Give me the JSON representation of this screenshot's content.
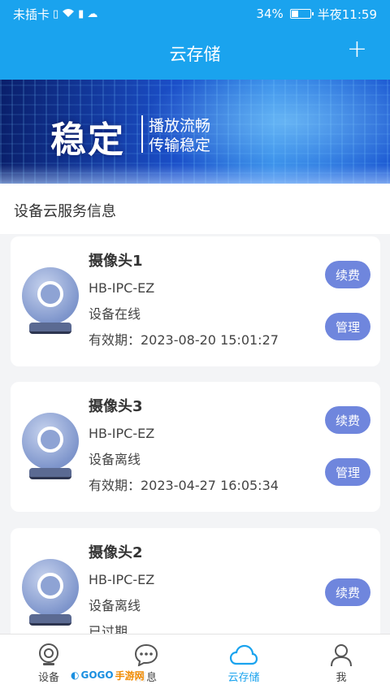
{
  "status_bar": {
    "carrier": "未插卡",
    "battery": "34%",
    "battery_level": 0.34,
    "time": "半夜11:59"
  },
  "header": {
    "title": "云存储",
    "add_label": "+"
  },
  "banner": {
    "big_text": "稳定",
    "line1": "播放流畅",
    "line2": "传输稳定"
  },
  "section": {
    "title": "设备云服务信息"
  },
  "devices": [
    {
      "name": "摄像头1",
      "model": "HB-IPC-EZ",
      "status": "设备在线",
      "expiry": "有效期：2023-08-20 15:01:27",
      "renew_label": "续费",
      "manage_label": "管理"
    },
    {
      "name": "摄像头3",
      "model": "HB-IPC-EZ",
      "status": "设备离线",
      "expiry": "有效期：2023-04-27 16:05:34",
      "renew_label": "续费",
      "manage_label": "管理"
    },
    {
      "name": "摄像头2",
      "model": "HB-IPC-EZ",
      "status": "设备离线",
      "expiry": "已过期",
      "renew_label": "续费"
    }
  ],
  "nav": {
    "items": [
      {
        "label": "设备",
        "icon": "camera-icon"
      },
      {
        "label": "消息",
        "icon": "chat-icon"
      },
      {
        "label": "云存储",
        "icon": "cloud-icon",
        "active": true
      },
      {
        "label": "我",
        "icon": "person-icon"
      }
    ]
  },
  "watermark": {
    "text_a": "GOGO",
    "text_b": "手游网"
  },
  "colors": {
    "primary": "#1aa3ee",
    "button": "#6f86dd"
  }
}
